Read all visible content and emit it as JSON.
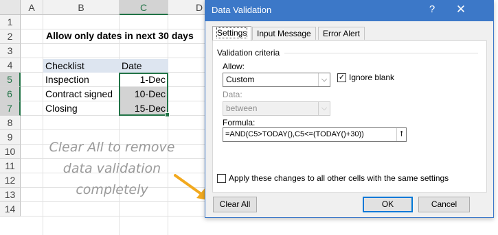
{
  "sheet": {
    "columns": [
      "A",
      "B",
      "C",
      "D"
    ],
    "rows": [
      "1",
      "2",
      "3",
      "4",
      "5",
      "6",
      "7",
      "8",
      "9",
      "10",
      "11",
      "12",
      "13",
      "14"
    ],
    "title": "Allow only dates in next 30 days",
    "table_headers": [
      "Checklist",
      "Date"
    ],
    "table_rows": [
      {
        "item": "Inspection",
        "date": "1-Dec"
      },
      {
        "item": "Contract signed",
        "date": "10-Dec"
      },
      {
        "item": "Closing",
        "date": "15-Dec"
      }
    ],
    "note_lines": [
      "Clear All to remove",
      "data validation",
      "completely"
    ],
    "accent": "#217346",
    "arrow_color": "#f2a91e"
  },
  "dialog": {
    "title": "Data Validation",
    "help_glyph": "?",
    "close_glyph": "✕",
    "tabs": [
      "Settings",
      "Input Message",
      "Error Alert"
    ],
    "active_tab": "Settings",
    "criteria_label": "Validation criteria",
    "allow_label": "Allow:",
    "allow_value": "Custom",
    "ignore_blank_label": "Ignore blank",
    "ignore_blank_checked": true,
    "data_label": "Data:",
    "data_value": "between",
    "formula_label": "Formula:",
    "formula_value": "=AND(C5>TODAY(),C5<=(TODAY()+30))",
    "apply_label": "Apply these changes to all other cells with the same settings",
    "apply_checked": false,
    "clear_all": "Clear All",
    "ok": "OK",
    "cancel": "Cancel",
    "titlebar_color": "#3c78c8"
  }
}
